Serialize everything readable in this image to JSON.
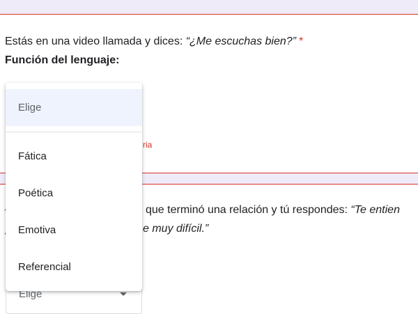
{
  "question1": {
    "prefix": "Estás en una video llamada y dices: ",
    "quote_open": "“",
    "quote_text": "¿Me escuchas bien?",
    "quote_close": "”",
    "required_mark": "*",
    "subtitle": "Función del lenguaje:",
    "error_fragment": "ria"
  },
  "dropdown": {
    "placeholder": "Elige",
    "options": [
      "Fática",
      "Poética",
      "Emotiva",
      "Referencial"
    ]
  },
  "question2": {
    "visible_line1_plain": " que terminó una relación y tú respondes: ",
    "visible_line1_italic": "“Te entien",
    "visible_line2_italic": "e muy difícil.”"
  },
  "closed_select": {
    "value": "Elige",
    "icon": "caret-down-icon"
  },
  "colors": {
    "band_background": "#f0ebf8",
    "error_red": "#d93025",
    "selected_option_bg": "#eef3fd"
  }
}
